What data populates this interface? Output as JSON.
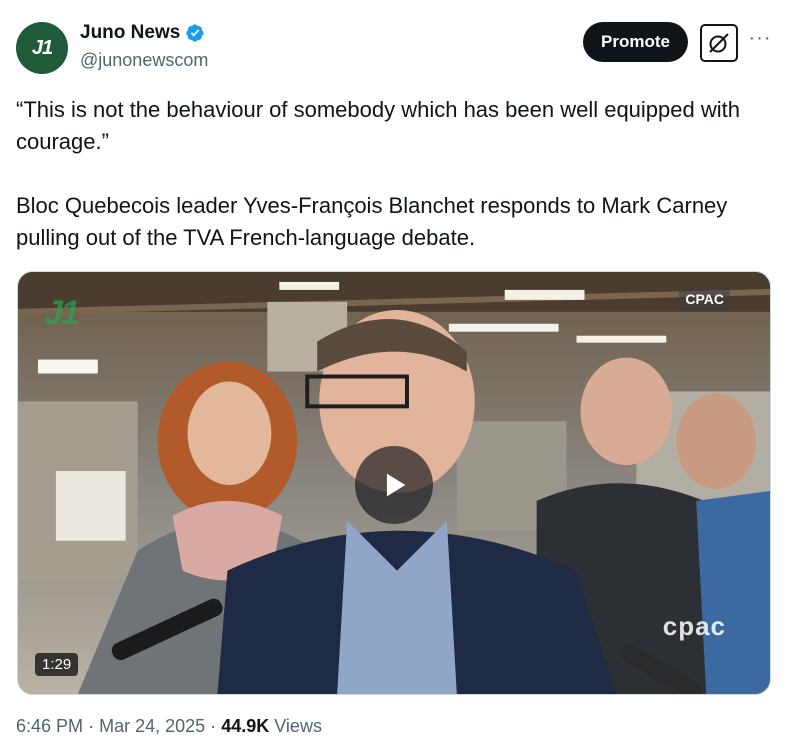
{
  "account": {
    "display_name": "Juno News",
    "handle": "@junonewscom",
    "avatar_text": "J1",
    "verified": true
  },
  "actions": {
    "promote_label": "Promote",
    "grok_icon": "grok-icon",
    "more_icon": "more-icon"
  },
  "tweet": {
    "quote": "“This is not the behaviour of somebody which has been well equipped with courage.”",
    "body": "Bloc Quebecois leader Yves-François Blanchet responds to Mark Carney pulling out of the TVA French-language debate."
  },
  "media": {
    "type": "video",
    "network_badge": "CPAC",
    "network_logo": "cpac",
    "watermark": "J1",
    "duration": "1:29",
    "play_icon": "play-icon"
  },
  "meta": {
    "time": "6:46 PM",
    "separator": "·",
    "date": "Mar 24, 2025",
    "views_count": "44.9K",
    "views_label": "Views"
  },
  "colors": {
    "text": "#0f1419",
    "secondary": "#536471",
    "verified_blue": "#1d9bf0",
    "promote_bg": "#0f1419"
  }
}
